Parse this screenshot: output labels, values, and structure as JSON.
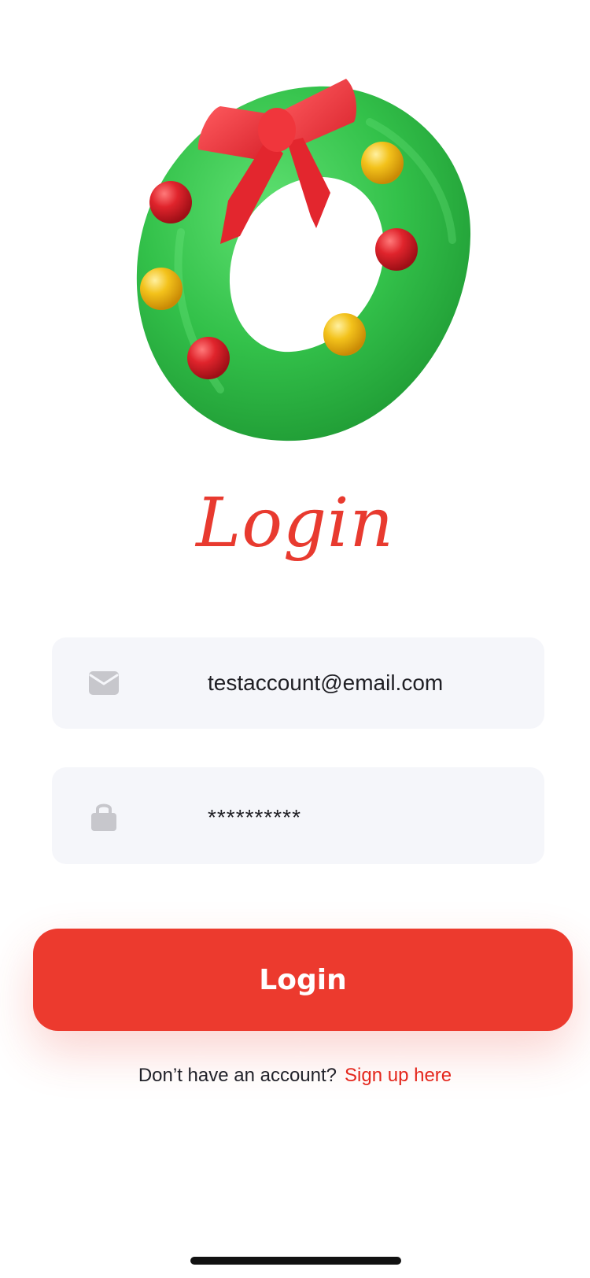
{
  "screen": {
    "title": "Login"
  },
  "hero": {
    "icon": "christmas-wreath-illustration"
  },
  "form": {
    "email": {
      "icon": "envelope-icon",
      "value": "testaccount@email.com"
    },
    "password": {
      "icon": "lock-icon",
      "value": "**********"
    }
  },
  "actions": {
    "login_label": "Login"
  },
  "signup": {
    "prompt": "Don’t have an account?",
    "link_label": "Sign up here"
  },
  "colors": {
    "accent": "#ec3a2e",
    "link": "#e4261c",
    "field_bg": "#f5f6fa",
    "wreath_green": "#2fbf45"
  }
}
